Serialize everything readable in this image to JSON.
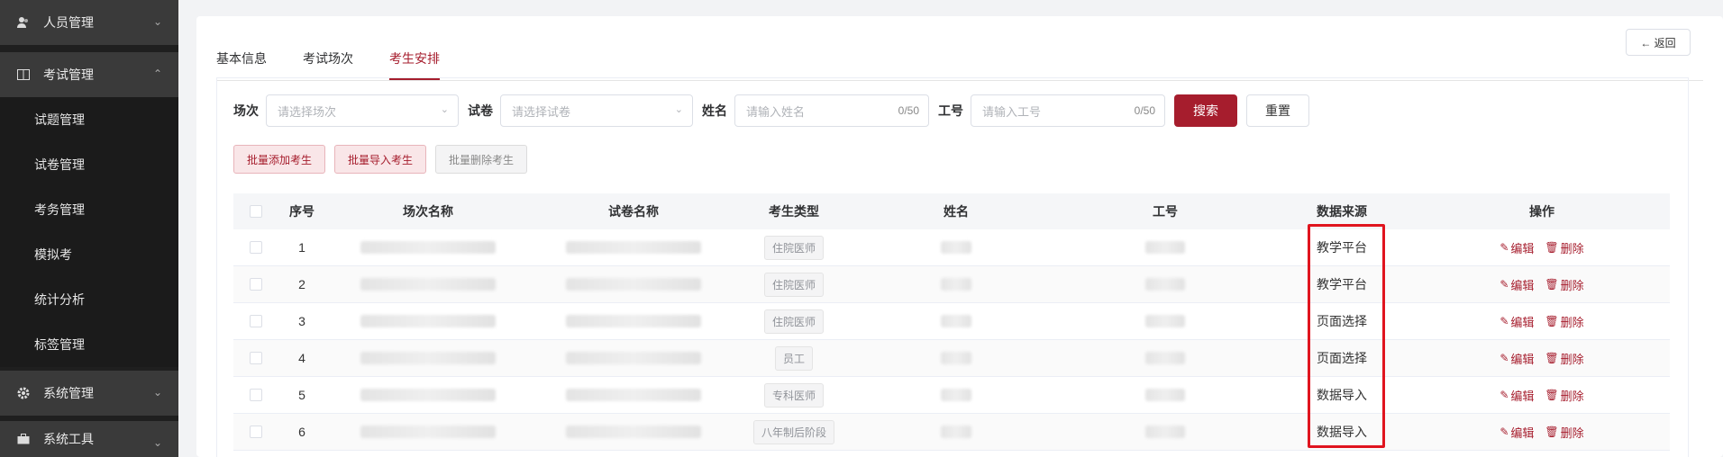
{
  "sidebar": {
    "groups": [
      {
        "label": "人员管理",
        "icon": "users-icon",
        "chevron": "⌄"
      },
      {
        "label": "考试管理",
        "icon": "book-icon",
        "chevron": "⌃"
      },
      {
        "label": "系统管理",
        "icon": "gear-icon",
        "chevron": "⌄"
      },
      {
        "label": "系统工具",
        "icon": "toolbox-icon",
        "chevron": "⌄"
      }
    ],
    "sub_items": [
      "试题管理",
      "试卷管理",
      "考务管理",
      "模拟考",
      "统计分析",
      "标签管理"
    ]
  },
  "tabs": [
    "基本信息",
    "考试场次",
    "考生安排"
  ],
  "active_tab": "考生安排",
  "back_button": "← 返回",
  "filters": {
    "session_label": "场次",
    "session_placeholder": "请选择场次",
    "paper_label": "试卷",
    "paper_placeholder": "请选择试卷",
    "name_label": "姓名",
    "name_placeholder": "请输入姓名",
    "name_count": "0/50",
    "id_label": "工号",
    "id_placeholder": "请输入工号",
    "id_count": "0/50",
    "search_button": "搜索",
    "reset_button": "重置"
  },
  "actions": {
    "batch_add": "批量添加考生",
    "batch_import": "批量导入考生",
    "batch_delete": "批量删除考生"
  },
  "table": {
    "headers": [
      "序号",
      "场次名称",
      "试卷名称",
      "考生类型",
      "姓名",
      "工号",
      "数据来源",
      "操作"
    ],
    "rows": [
      {
        "index": "1",
        "type": "住院医师",
        "source": "教学平台"
      },
      {
        "index": "2",
        "type": "住院医师",
        "source": "教学平台"
      },
      {
        "index": "3",
        "type": "住院医师",
        "source": "页面选择"
      },
      {
        "index": "4",
        "type": "员工",
        "source": "页面选择"
      },
      {
        "index": "5",
        "type": "专科医师",
        "source": "数据导入"
      },
      {
        "index": "6",
        "type": "八年制后阶段",
        "source": "数据导入"
      }
    ],
    "edit_label": "编辑",
    "delete_label": "删除"
  },
  "colors": {
    "accent": "#a61d2d",
    "highlight": "#e0141e",
    "sidebar": "#1f1f1f"
  }
}
